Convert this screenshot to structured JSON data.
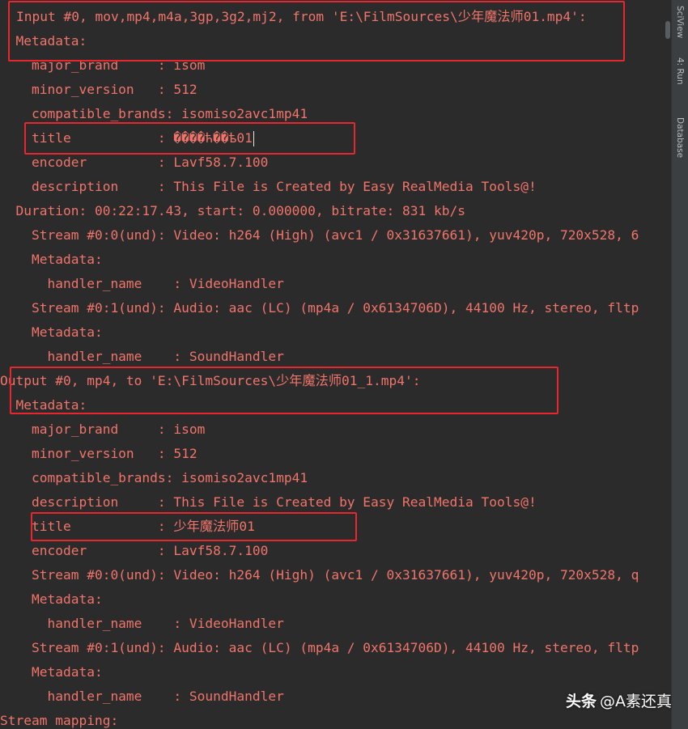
{
  "console": {
    "lines": [
      "Input #0, mov,mp4,m4a,3gp,3g2,mj2, from 'E:\\FilmSources\\少年魔法师01.mp4':",
      "  Metadata:",
      "    major_brand     : isom",
      "    minor_version   : 512",
      "    compatible_brands: isomiso2avc1mp41",
      "    title           : ����ћ��ѣ01",
      "    encoder         : Lavf58.7.100",
      "    description     : This File is Created by Easy RealMedia Tools@!",
      "  Duration: 00:22:17.43, start: 0.000000, bitrate: 831 kb/s",
      "    Stream #0:0(und): Video: h264 (High) (avc1 / 0x31637661), yuv420p, 720x528, 6",
      "    Metadata:",
      "      handler_name    : VideoHandler",
      "    Stream #0:1(und): Audio: aac (LC) (mp4a / 0x6134706D), 44100 Hz, stereo, fltp",
      "    Metadata:",
      "      handler_name    : SoundHandler",
      "Output #0, mp4, to 'E:\\FilmSources\\少年魔法师01_1.mp4':",
      "  Metadata:",
      "    major_brand     : isom",
      "    minor_version   : 512",
      "    compatible_brands: isomiso2avc1mp41",
      "    description     : This File is Created by Easy RealMedia Tools@!",
      "    title           : 少年魔法师01",
      "    encoder         : Lavf58.7.100",
      "    Stream #0:0(und): Video: h264 (High) (avc1 / 0x31637661), yuv420p, 720x528, q",
      "    Metadata:",
      "      handler_name    : VideoHandler",
      "    Stream #0:1(und): Audio: aac (LC) (mp4a / 0x6134706D), 44100 Hz, stereo, fltp",
      "    Metadata:",
      "      handler_name    : SoundHandler",
      "Stream mapping:"
    ]
  },
  "sidebar": {
    "tabs": [
      {
        "label": "SciView"
      },
      {
        "label": "4: Run"
      },
      {
        "label": "Database"
      }
    ]
  },
  "watermark": {
    "brand": "头条",
    "handle": "@A素还真"
  },
  "colors": {
    "background": "#2b2b2b",
    "text": "#f0746a",
    "highlight": "#e8262d",
    "sidebar": "#3c3f41"
  }
}
